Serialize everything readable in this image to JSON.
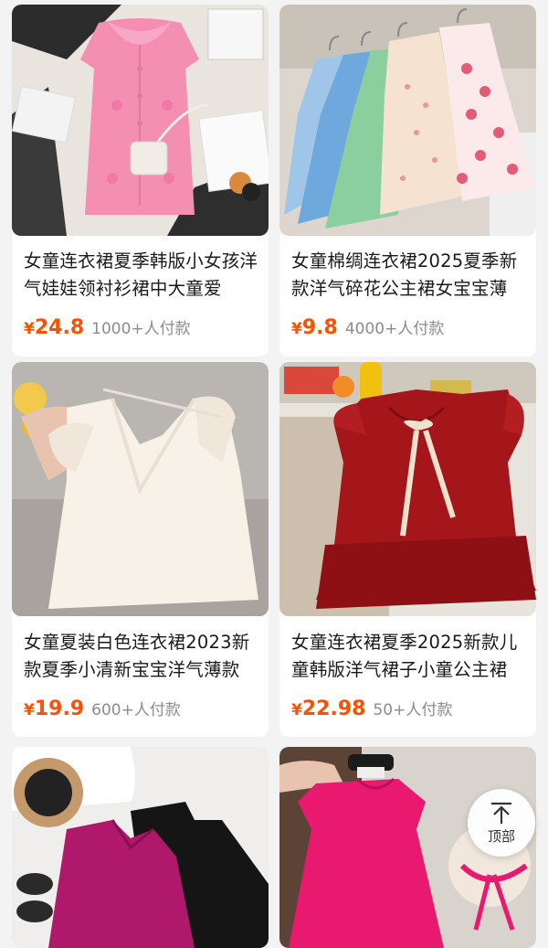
{
  "products": [
    {
      "title": "女童连衣裙夏季韩版小女孩洋气娃娃领衬衫裙中大童爱",
      "currency": "¥",
      "price": "24.8",
      "sales": "1000+人付款",
      "image": {
        "subject": "pink-puff-sleeve-dress",
        "primary_color": "#f48fb1"
      }
    },
    {
      "title": "女童棉绸连衣裙2025夏季新款洋气碎花公主裙女宝宝薄",
      "currency": "¥",
      "price": "9.8",
      "sales": "4000+人付款",
      "image": {
        "subject": "floral-sleeveless-dresses-on-hangers",
        "primary_color": "#f7d9c4"
      }
    },
    {
      "title": "女童夏装白色连衣裙2023新款夏季小清新宝宝洋气薄款",
      "currency": "¥",
      "price": "19.9",
      "sales": "600+人付款",
      "image": {
        "subject": "white-lace-ruffle-dress",
        "primary_color": "#f7efe6"
      }
    },
    {
      "title": "女童连衣裙夏季2025新款儿童韩版洋气裙子小童公主裙",
      "currency": "¥",
      "price": "22.98",
      "sales": "50+人付款",
      "image": {
        "subject": "red-ruffle-dress-with-ribbon",
        "primary_color": "#a4161a"
      }
    },
    {
      "title": "",
      "currency": "",
      "price": "",
      "sales": "",
      "image": {
        "subject": "magenta-and-black-dresses",
        "primary_color": "#b0186b"
      }
    },
    {
      "title": "",
      "currency": "",
      "price": "",
      "sales": "",
      "image": {
        "subject": "hot-pink-dress-with-sunglasses",
        "primary_color": "#e8196e"
      }
    }
  ],
  "scroll_top_button": {
    "label": "顶部",
    "icon": "arrow-up-icon"
  },
  "colors": {
    "price": "#ff5000",
    "sales": "#8c8c8c",
    "background": "#f3f3f3"
  }
}
